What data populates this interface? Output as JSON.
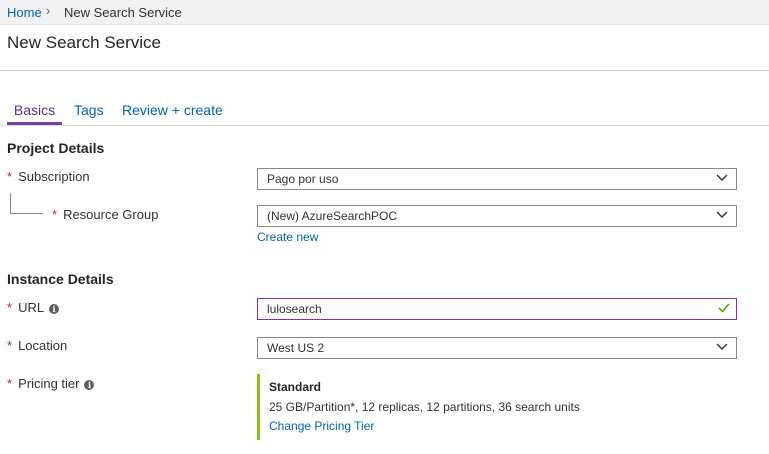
{
  "breadcrumb": {
    "home": "Home",
    "separator": "›",
    "current": "New Search Service"
  },
  "page": {
    "title": "New Search Service"
  },
  "tabs": [
    {
      "label": "Basics",
      "active": true
    },
    {
      "label": "Tags",
      "active": false
    },
    {
      "label": "Review + create",
      "active": false
    }
  ],
  "sections": {
    "project_details": "Project Details",
    "instance_details": "Instance Details"
  },
  "fields": {
    "subscription": {
      "label": "Subscription",
      "required": "*",
      "value": "Pago por uso"
    },
    "resource_group": {
      "label": "Resource Group",
      "required": "*",
      "value": "(New) AzureSearchPOC",
      "create_link": "Create new"
    },
    "url": {
      "label": "URL",
      "required": "*",
      "info": "i",
      "value": "lulosearch",
      "status": "valid"
    },
    "location": {
      "label": "Location",
      "required": "*",
      "value": "West US 2"
    },
    "pricing_tier": {
      "label": "Pricing tier",
      "required": "*",
      "info": "i",
      "tier_name": "Standard",
      "tier_description": "25 GB/Partition*, 12 replicas, 12 partitions, 36 search units",
      "change_link": "Change Pricing Tier"
    }
  },
  "icons": {
    "chevron": "chevron-down-icon",
    "check": "checkmark-icon",
    "info": "info-icon"
  },
  "colors": {
    "link": "#0063b1",
    "active_tab": "#7b3fa0",
    "required_star": "#a4262c",
    "valid_check": "#57a300",
    "tier_accent": "#8cbd18"
  }
}
